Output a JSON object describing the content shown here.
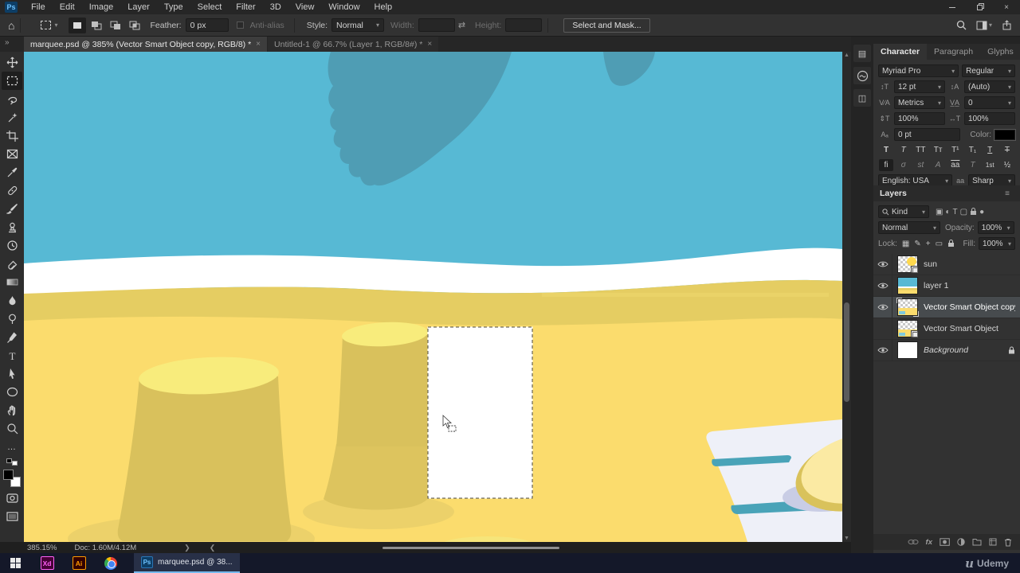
{
  "titlebar": {
    "app_badge": "Ps",
    "menus": [
      "File",
      "Edit",
      "Image",
      "Layer",
      "Type",
      "Select",
      "Filter",
      "3D",
      "View",
      "Window",
      "Help"
    ]
  },
  "options": {
    "feather_label": "Feather:",
    "feather_value": "0 px",
    "antialias_label": "Anti-alias",
    "style_label": "Style:",
    "style_value": "Normal",
    "width_label": "Width:",
    "width_value": "",
    "height_label": "Height:",
    "height_value": "",
    "select_mask_label": "Select and Mask..."
  },
  "tabs": [
    {
      "title": "marquee.psd @ 385% (Vector Smart Object copy, RGB/8) *",
      "close": "×"
    },
    {
      "title": "Untitled-1 @ 66.7% (Layer 1, RGB/8#) *",
      "close": "×"
    }
  ],
  "toolbar": {
    "tools": [
      "move",
      "rectangular-marquee",
      "lasso",
      "quick-selection",
      "crop",
      "frame",
      "eyedropper",
      "spot-healing",
      "brush",
      "clone-stamp",
      "history-brush",
      "eraser",
      "gradient",
      "blur",
      "dodge",
      "pen",
      "type",
      "path-selection",
      "ellipse",
      "hand",
      "zoom",
      "edit-toolbar"
    ]
  },
  "character_panel": {
    "tabs": [
      "Character",
      "Paragraph",
      "Glyphs"
    ],
    "font_family": "Myriad Pro",
    "font_style": "Regular",
    "size": "12 pt",
    "leading": "(Auto)",
    "kerning": "Metrics",
    "tracking": "0",
    "vertical_scale": "100%",
    "horizontal_scale": "100%",
    "baseline": "0 pt",
    "color_label": "Color:",
    "style_glyphs": [
      "T",
      "T",
      "TT",
      "Tᴛ",
      "T¹",
      "T₁",
      "T",
      "T"
    ],
    "ot_glyphs": [
      "fi",
      "σ",
      "st",
      "A",
      "aa",
      "T",
      "1st",
      "½"
    ],
    "language": "English: USA",
    "aa_label": "aa",
    "antialias": "Sharp"
  },
  "layers_panel": {
    "title": "Layers",
    "kind": "Kind",
    "blend_mode": "Normal",
    "opacity_label": "Opacity:",
    "opacity": "100%",
    "lock_label": "Lock:",
    "fill_label": "Fill:",
    "fill": "100%",
    "filter_type_label": "T",
    "layers": [
      {
        "name": "sun"
      },
      {
        "name": "layer 1"
      },
      {
        "name": "Vector Smart Object copy"
      },
      {
        "name": "Vector Smart Object"
      },
      {
        "name": "Background"
      }
    ]
  },
  "status": {
    "zoom": "385.15%",
    "doc": "Doc: 1.60M/4.12M"
  },
  "taskbar": {
    "task_title": "marquee.psd @ 38...",
    "brand": "Udemy"
  },
  "canvas_palette": {
    "sky": "#57b9d4",
    "cloud": "#4f9db4",
    "foam": "#ffffff",
    "sand_band": "#e5cd62",
    "sand_bright": "#fbdc6d",
    "bucket": "#d9c15c",
    "bucket_top": "#f8ec7c",
    "towel": "#eef0f8",
    "stripe": "#49a3b8",
    "hat": "#fbeaa3",
    "hat_rim": "#d9c25b",
    "hat_shadow": "#c9cde5"
  }
}
